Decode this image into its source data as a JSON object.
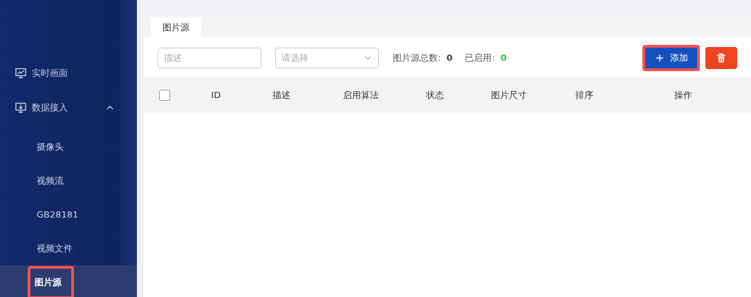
{
  "sidebar": {
    "items": [
      {
        "label": "实时画面"
      },
      {
        "label": "数据接入",
        "expanded": true,
        "children": [
          {
            "label": "摄像头",
            "selected": false,
            "highlighted": false
          },
          {
            "label": "视频流",
            "selected": false,
            "highlighted": false
          },
          {
            "label": "GB28181",
            "selected": false,
            "highlighted": false
          },
          {
            "label": "视频文件",
            "selected": false,
            "highlighted": false
          },
          {
            "label": "图片源",
            "selected": true,
            "highlighted": true
          }
        ]
      }
    ]
  },
  "tabs": [
    {
      "label": "图片源",
      "selected": true
    }
  ],
  "toolbar": {
    "description_field": {
      "placeholder": "描述"
    },
    "select": {
      "placeholder": "请选择"
    },
    "stats": [
      {
        "label": "图片源总数:",
        "value": "0",
        "color": "#3a4a5c"
      },
      {
        "label": "已启用:",
        "value": "0",
        "color": "#2ecc2e"
      }
    ],
    "add_button": {
      "label": "添加",
      "highlighted": true
    }
  },
  "table": {
    "select_all_checked": false,
    "columns": [
      "ID",
      "描述",
      "启用算法",
      "状态",
      "图片尺寸",
      "排序",
      "操作"
    ]
  }
}
